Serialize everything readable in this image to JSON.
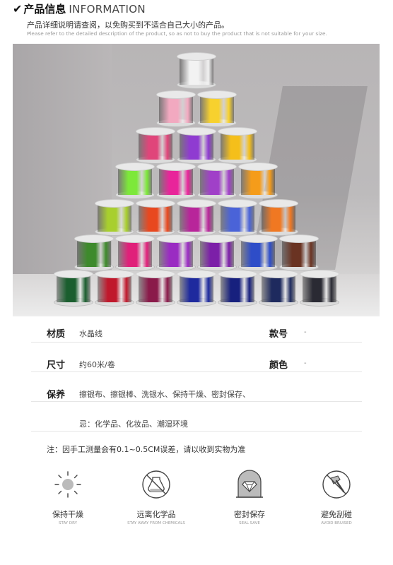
{
  "header": {
    "check_icon": "check-icon",
    "title_cn": "产品信息",
    "title_en": "INFORMATION",
    "subtitle_cn": "产品详细说明请查阅，以免购买到不适合自己大小的产品。",
    "subtitle_en": "Please refer to the detailed description of the product, so as not to buy the product that is not suitable for your size."
  },
  "photo": {
    "description_colors": [
      "#f2f2f2",
      "#f2a9c0",
      "#f7d12e",
      "#e0457a",
      "#8f3bd1",
      "#f5bf1a",
      "#7de83a",
      "#e8259a",
      "#a040c8",
      "#f59c1a",
      "#a8cf2e",
      "#e8481f",
      "#b8259a",
      "#4a63d8",
      "#f07822",
      "#3e8a2c",
      "#e0207a",
      "#9a2cc2",
      "#7c1fa8",
      "#2e4dc8",
      "#6a3322",
      "#1a5e2e",
      "#c0182c",
      "#8a1a4a",
      "#1e2a9e",
      "#17207e",
      "#1e2a5e",
      "#2a2a33"
    ]
  },
  "specs": {
    "material_label": "材质",
    "material_value": "水晶线",
    "model_label": "款号",
    "model_value": "-",
    "size_label": "尺寸",
    "size_value": "约60米/卷",
    "color_label": "颜色",
    "color_value": "-",
    "care_label": "保养",
    "care_line1": "擦银布、擦银棒、洗银水、保持干燥、密封保存、",
    "care_line2": "忌：化学品、化妆品、潮湿环境"
  },
  "note": "注：因手工测量会有0.1~0.5CM误差，请以收到实物为准",
  "care_icons": [
    {
      "icon": "sun-icon",
      "cn": "保持干燥",
      "en": "STAY DRY"
    },
    {
      "icon": "no-chemicals-icon",
      "cn": "远离化学品",
      "en": "STAY AWAY FROM CHEMICALS"
    },
    {
      "icon": "diamond-seal-icon",
      "cn": "密封保存",
      "en": "SEAL SAVE"
    },
    {
      "icon": "no-hammer-icon",
      "cn": "避免刮碰",
      "en": "AVOID BRUISED"
    }
  ]
}
